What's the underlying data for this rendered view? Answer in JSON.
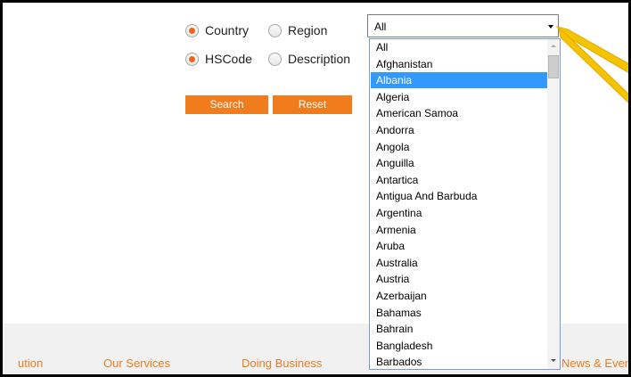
{
  "search_mode": {
    "options_row1": [
      {
        "label": "Country",
        "checked": true
      },
      {
        "label": "Region",
        "checked": false
      }
    ],
    "options_row2": [
      {
        "label": "HSCode",
        "checked": true
      },
      {
        "label": "Description",
        "checked": false
      }
    ]
  },
  "buttons": {
    "search_label": "Search",
    "reset_label": "Reset"
  },
  "country_select": {
    "selected_value": "All",
    "highlighted_option": "Albania",
    "options": [
      "All",
      "Afghanistan",
      "Albania",
      "Algeria",
      "American Samoa",
      "Andorra",
      "Angola",
      "Anguilla",
      "Antartica",
      "Antigua And Barbuda",
      "Argentina",
      "Armenia",
      "Aruba",
      "Australia",
      "Austria",
      "Azerbaijan",
      "Bahamas",
      "Bahrain",
      "Bangladesh",
      "Barbados"
    ]
  },
  "footer": {
    "links": [
      "ution",
      "Our Services",
      "Doing Business",
      "News & Events"
    ]
  },
  "colors": {
    "accent": "#f07c1e",
    "selection": "#3399ff",
    "footer_bg": "#f1f1f1",
    "callout": "#f5c400"
  }
}
